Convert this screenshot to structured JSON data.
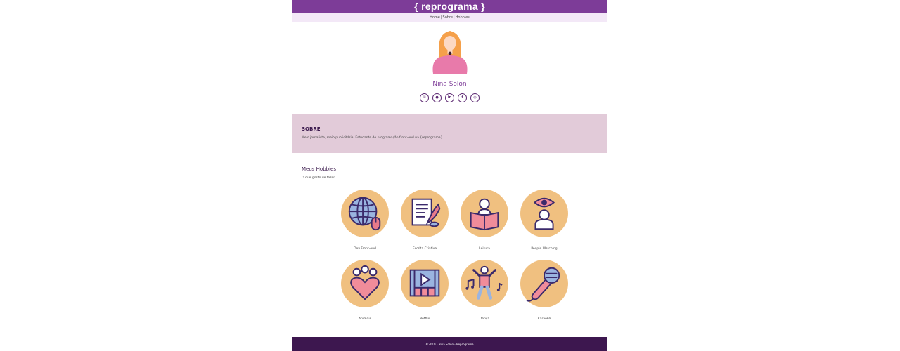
{
  "header": {
    "brand": "{ reprograma }"
  },
  "nav": {
    "items": [
      {
        "label": "Home"
      },
      {
        "label": "Sobre"
      },
      {
        "label": "Hobbies"
      }
    ],
    "separator": "|"
  },
  "profile": {
    "name": "Nina Solon",
    "social": [
      {
        "icon": "email-icon",
        "glyph": "✉"
      },
      {
        "icon": "github-icon",
        "glyph": "●"
      },
      {
        "icon": "linkedin-icon",
        "glyph": "in"
      },
      {
        "icon": "facebook-icon",
        "glyph": "f"
      },
      {
        "icon": "instagram-icon",
        "glyph": "◎"
      }
    ]
  },
  "sobre": {
    "title": "SOBRE",
    "text": "Meio jornalista, meio publicitária. Estudante de programação front-end na {reprograma}"
  },
  "hobbies": {
    "title": "Meus Hobbies",
    "subtitle": "O que gosto de fazer",
    "items": [
      {
        "label": "Dev Front-end",
        "icon": "globe-mouse-icon"
      },
      {
        "label": "Escrita Criativa",
        "icon": "paper-quill-icon"
      },
      {
        "label": "Leitura",
        "icon": "person-reading-icon"
      },
      {
        "label": "People Watching",
        "icon": "eye-person-icon"
      },
      {
        "label": "Animais",
        "icon": "heart-paw-icon"
      },
      {
        "label": "Netflix",
        "icon": "film-play-icon"
      },
      {
        "label": "Dança",
        "icon": "dancing-person-icon"
      },
      {
        "label": "Karaokê",
        "icon": "microphone-icon"
      }
    ]
  },
  "footer": {
    "text": "©2019 - Nina Solon - Reprograma"
  },
  "colors": {
    "purple": "#7d3c98",
    "lavender": "#f3e8f7",
    "rose": "#e2cbd9",
    "peach": "#f0c080",
    "darkPurple": "#3d174f"
  }
}
